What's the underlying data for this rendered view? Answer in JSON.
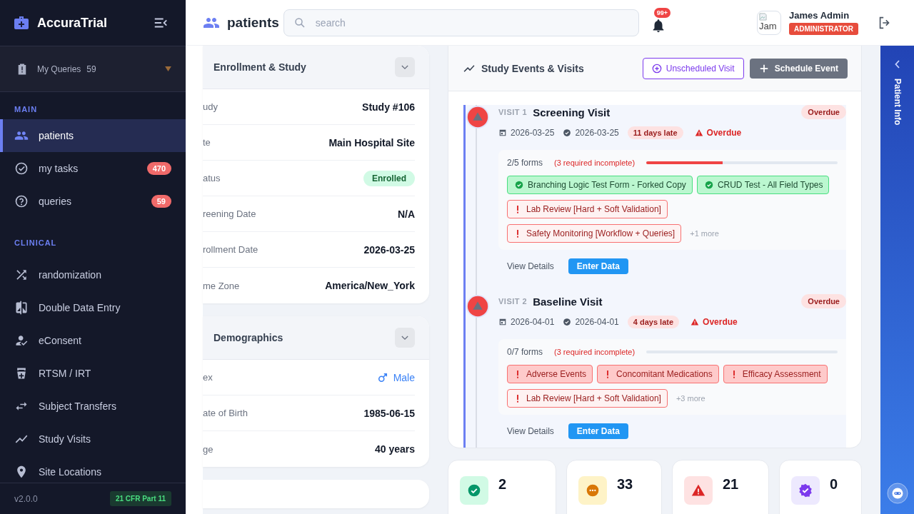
{
  "sidebar": {
    "brand": "AccuraTrial",
    "queries": {
      "label": "My Queries",
      "count": "59"
    },
    "sections": [
      {
        "title": "MAIN",
        "items": [
          {
            "label": "patients",
            "selected": true
          },
          {
            "label": "my tasks",
            "selected": false,
            "badge": "470"
          },
          {
            "label": "queries",
            "selected": false,
            "badge": "59"
          }
        ]
      },
      {
        "title": "CLINICAL",
        "items": [
          {
            "label": "randomization",
            "selected": false
          },
          {
            "label": "Double Data Entry",
            "selected": false
          },
          {
            "label": "eConsent",
            "selected": false
          },
          {
            "label": "RTSM / IRT",
            "selected": false
          },
          {
            "label": "Subject Transfers",
            "selected": false
          },
          {
            "label": "Study Visits",
            "selected": false
          },
          {
            "label": "Site Locations",
            "selected": false
          }
        ]
      }
    ],
    "version": "v2.0.0",
    "compliance": "21 CFR Part 11"
  },
  "header": {
    "title": "patients",
    "search": {
      "placeholder": "search"
    },
    "notifications": "99+",
    "avatar_alt": "Jam",
    "user": {
      "name": "James Admin",
      "role": "ADMINISTRATOR"
    }
  },
  "info_cards": [
    {
      "title": "Enrollment & Study",
      "rows": [
        {
          "label": "udy",
          "value": "Study #106",
          "kind": "text"
        },
        {
          "label": "te",
          "value": "Main Hospital Site",
          "kind": "text"
        },
        {
          "label": "atus",
          "value": "Enrolled",
          "kind": "badge"
        },
        {
          "label": "reening Date",
          "value": "N/A",
          "kind": "text"
        },
        {
          "label": "rollment Date",
          "value": "2026-03-25",
          "kind": "text"
        },
        {
          "label": "me Zone",
          "value": "America/New_York",
          "kind": "text"
        }
      ]
    },
    {
      "title": "Demographics",
      "rows": [
        {
          "label": "ex",
          "value": "Male",
          "kind": "gender"
        },
        {
          "label": "ate of Birth",
          "value": "1985-06-15",
          "kind": "text"
        },
        {
          "label": "ge",
          "value": "40 years",
          "kind": "text"
        }
      ]
    }
  ],
  "visits_card": {
    "title": "Study Events & Visits",
    "unscheduled_button": "Unscheduled Visit",
    "schedule_button": "Schedule Event",
    "visits": [
      {
        "number": "VISIT 1",
        "title": "Screening Visit",
        "overdue": true,
        "badge": "Overdue",
        "scheduled": "2026-03-25",
        "actual": "2026-03-25",
        "late": "11 days late",
        "alert": "Overdue",
        "forms_count": "2/5 forms",
        "required": "(3 required incomplete)",
        "level": 0.4,
        "forms": [
          {
            "name": "Branching Logic Test Form - Forked Copy",
            "kind": "complete"
          },
          {
            "name": "CRUD Test - All Field Types",
            "kind": "complete"
          },
          {
            "name": "Lab Review [Hard + Soft Validation]",
            "kind": "pending"
          },
          {
            "name": "Safety Monitoring [Workflow + Queries]",
            "kind": "pending"
          }
        ],
        "more": "+1 more",
        "details": "View Details",
        "enter": "Enter Data"
      },
      {
        "number": "VISIT 2",
        "title": "Baseline Visit",
        "overdue": true,
        "badge": "Overdue",
        "scheduled": "2026-04-01",
        "actual": "2026-04-01",
        "late": "4 days late",
        "alert": "Overdue",
        "forms_count": "0/7 forms",
        "required": "(3 required incomplete)",
        "level": 0,
        "forms": [
          {
            "name": "Adverse Events",
            "kind": "required"
          },
          {
            "name": "Concomitant Medications",
            "kind": "required"
          },
          {
            "name": "Efficacy Assessment",
            "kind": "required"
          },
          {
            "name": "Lab Review [Hard + Soft Validation]",
            "kind": "pending"
          }
        ],
        "more": "+3 more",
        "details": "View Details",
        "enter": "Enter Data"
      }
    ]
  },
  "stats": [
    {
      "value": "2",
      "color": "#059669"
    },
    {
      "value": "33",
      "color": "#d97706"
    },
    {
      "value": "21",
      "color": "#dc2626"
    },
    {
      "value": "0",
      "color": "#7c3aed"
    }
  ],
  "patient_panel": {
    "title": "Patient Info"
  }
}
